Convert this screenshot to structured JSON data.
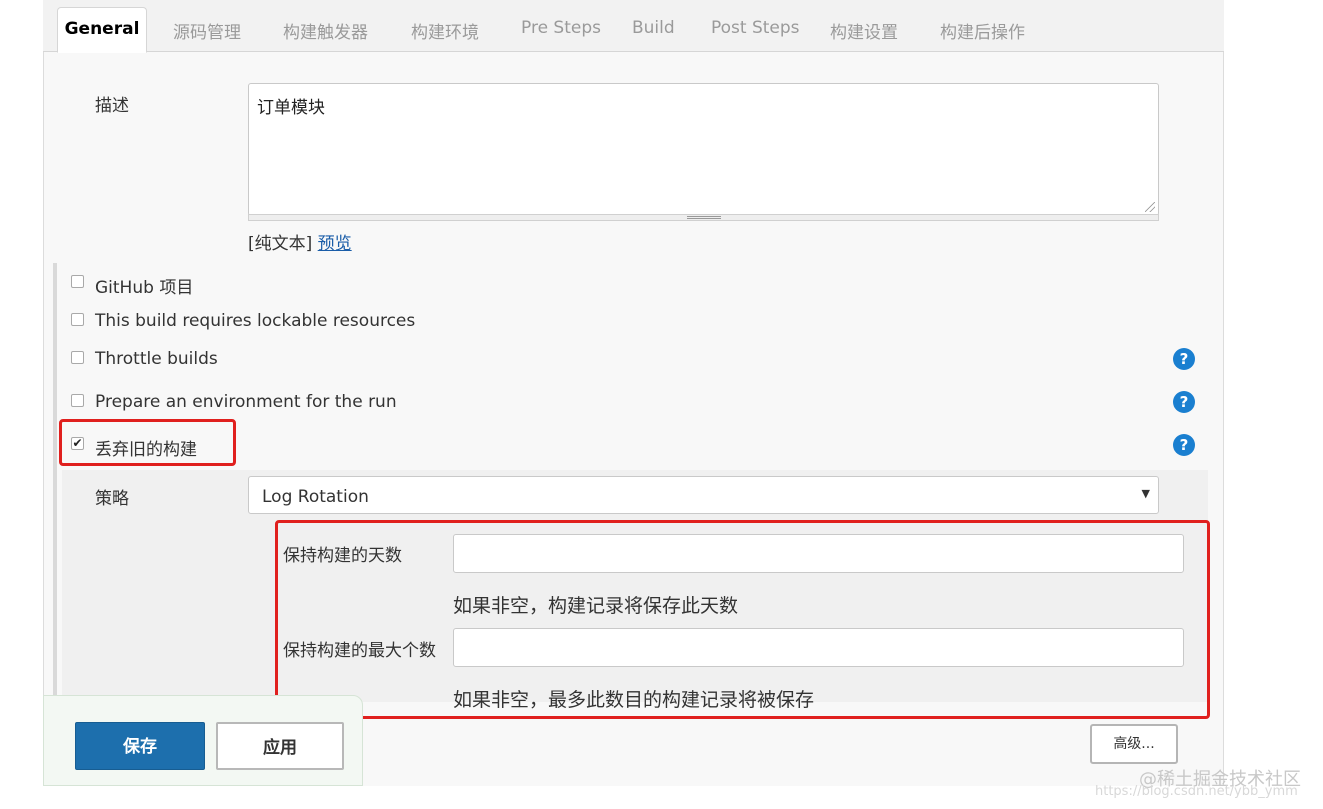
{
  "tabs": [
    "General",
    "源码管理",
    "构建触发器",
    "构建环境",
    "Pre Steps",
    "Build",
    "Post Steps",
    "构建设置",
    "构建后操作"
  ],
  "description": {
    "label": "描述",
    "value": "订单模块",
    "format_text": "[纯文本]",
    "preview_link": "预览"
  },
  "options": [
    {
      "label": "GitHub 项目",
      "checked": false
    },
    {
      "label": "This build requires lockable resources",
      "checked": false
    },
    {
      "label": "Throttle builds",
      "checked": false
    },
    {
      "label": "Prepare an environment for the run",
      "checked": false
    },
    {
      "label": "丢弃旧的构建",
      "checked": true
    }
  ],
  "checkmark": "✔",
  "help_symbol": "?",
  "strategy": {
    "label": "策略",
    "selected": "Log Rotation",
    "arrow": "▼"
  },
  "days_to_keep": {
    "label": "保持构建的天数",
    "value": "",
    "hint": "如果非空，构建记录将保存此天数"
  },
  "max_builds": {
    "label": "保持构建的最大个数",
    "value": "",
    "hint": "如果非空，最多此数目的构建记录将被保存"
  },
  "buttons": {
    "save": "保存",
    "apply": "应用",
    "advanced": "高级..."
  },
  "watermark": {
    "main": "@稀土掘金技术社区",
    "url": "https://blog.csdn.net/ybb_ymm"
  },
  "colors": {
    "highlight_red": "#e0201e",
    "primary_blue": "#1d6fad",
    "help_blue": "#1a7fd0"
  }
}
